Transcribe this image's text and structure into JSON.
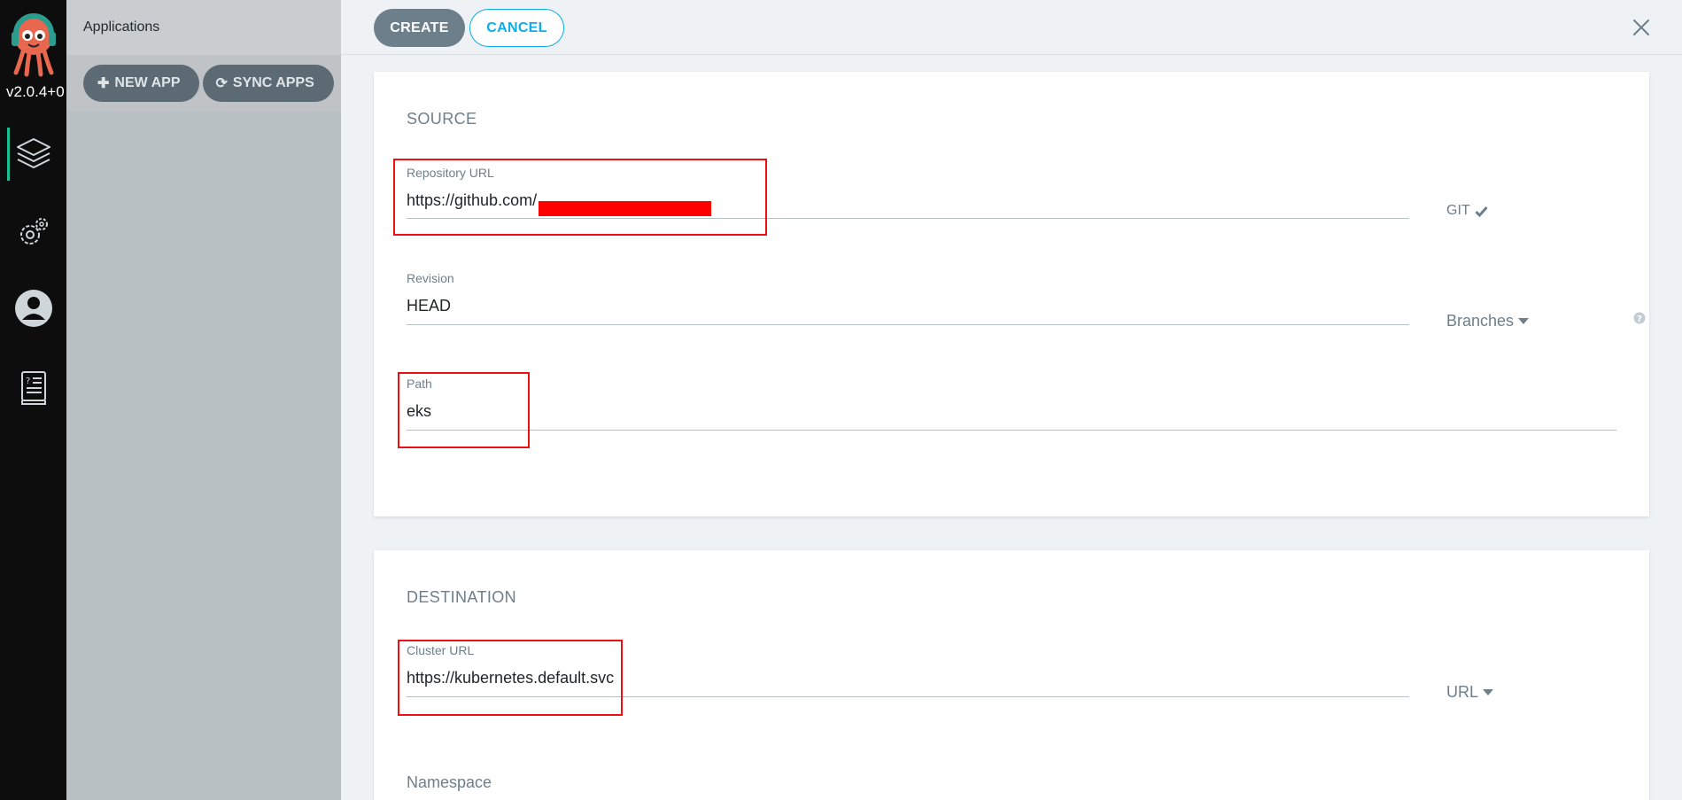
{
  "nav": {
    "version": "v2.0.4+0",
    "items": [
      "applications-icon",
      "settings-icon",
      "user-icon",
      "docs-icon"
    ]
  },
  "apps_panel": {
    "title": "Applications",
    "new_app_label": "NEW APP",
    "sync_apps_label": "SYNC APPS"
  },
  "header": {
    "create_label": "CREATE",
    "cancel_label": "CANCEL"
  },
  "source": {
    "title": "SOURCE",
    "repo_url_label": "Repository URL",
    "repo_url_value": "https://github.com/",
    "repo_type": "GIT",
    "revision_label": "Revision",
    "revision_value": "HEAD",
    "revision_mode": "Branches",
    "path_label": "Path",
    "path_value": "eks"
  },
  "destination": {
    "title": "DESTINATION",
    "cluster_url_label": "Cluster URL",
    "cluster_url_value": "https://kubernetes.default.svc",
    "cluster_mode": "URL",
    "namespace_label": "Namespace"
  },
  "colors": {
    "accent": "#0dadea",
    "highlight_box": "#ee1010",
    "nav_active": "#18be94"
  }
}
